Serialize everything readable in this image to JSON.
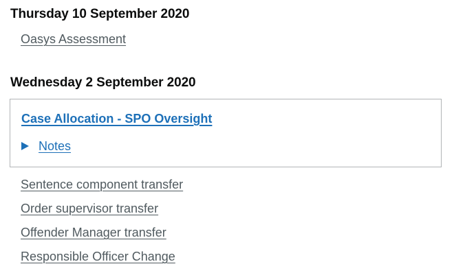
{
  "timeline": {
    "day1": {
      "date": "Thursday 10 September 2020",
      "items": [
        "Oasys Assessment"
      ]
    },
    "day2": {
      "date": "Wednesday 2 September 2020",
      "highlighted": {
        "title": "Case Allocation - SPO Oversight",
        "details_label": "Notes"
      },
      "items": [
        "Sentence component transfer",
        "Order supervisor transfer",
        "Offender Manager transfer",
        "Responsible Officer Change"
      ]
    }
  },
  "colors": {
    "link_blue": "#1d70b8",
    "secondary_link": "#505a5f",
    "text": "#0b0c0c",
    "border": "#b1b4b6"
  }
}
